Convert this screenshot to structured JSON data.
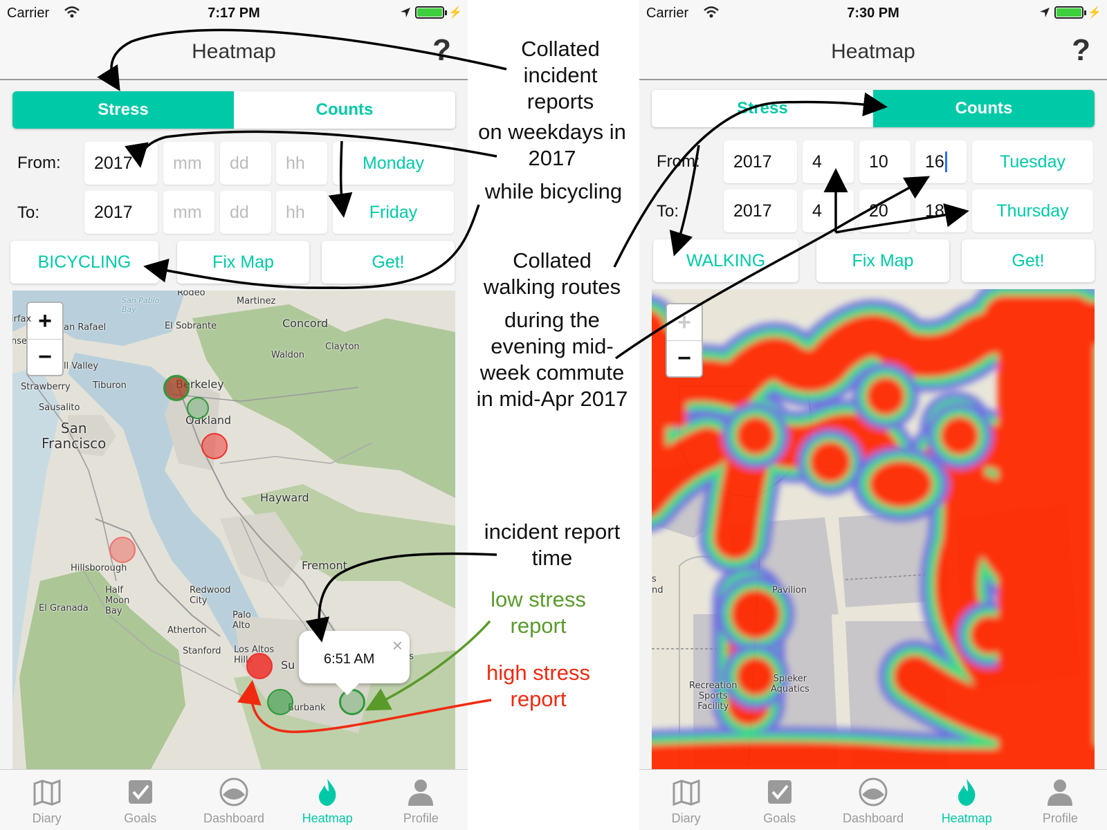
{
  "left": {
    "status": {
      "carrier": "Carrier",
      "time": "7:17 PM"
    },
    "nav_title": "Heatmap",
    "help_label": "?",
    "segments": {
      "stress": "Stress",
      "counts": "Counts",
      "selected": "stress"
    },
    "from_label": "From:",
    "to_label": "To:",
    "from": {
      "year": "2017",
      "month": "mm",
      "day": "dd",
      "hour": "hh",
      "weekday": "Monday"
    },
    "to": {
      "year": "2017",
      "month": "mm",
      "day": "dd",
      "hour": "hh",
      "weekday": "Friday"
    },
    "mode_button": "BICYCLING",
    "fix_map_button": "Fix Map",
    "get_button": "Get!",
    "zoom_in": "+",
    "zoom_out": "−",
    "map_places": {
      "rodeo": "Rodeo",
      "martinez": "Martinez",
      "san_pablo_bay": "San Pablo\nBay",
      "san_rafael": "an Rafael",
      "el_sobrante": "El Sobrante",
      "concord": "Concord",
      "clayton": "Clayton",
      "waldon": "Waldon",
      "mill_valley": "ll Valley",
      "strawberry": "Strawberry",
      "tiburon": "Tiburon",
      "berkeley": "Berkeley",
      "sausalito": "Sausalito",
      "oakland": "Oakland",
      "san_francisco": "San\nFrancisco",
      "hayward": "Hayward",
      "hillsborough": "Hillsborough",
      "fremont": "Fremont",
      "half_moon_bay": "Half\nMoon\nBay",
      "redwood_city": "Redwood\nCity",
      "el_granada": "El Granada",
      "palo_alto": "Palo\nAlto",
      "atherton": "Atherton",
      "stanford": "Stanford",
      "los_altos_hills": "Los Altos\nHills",
      "burbank": "Burbank",
      "fairfax": "irfax",
      "inverness": "nse",
      "su": "Su",
      "se": "se",
      "lls": "lls"
    },
    "popup_time": "6:51 AM",
    "popup_close": "×"
  },
  "right": {
    "status": {
      "carrier": "Carrier",
      "time": "7:30 PM"
    },
    "nav_title": "Heatmap",
    "help_label": "?",
    "segments": {
      "stress": "Stress",
      "counts": "Counts",
      "selected": "counts"
    },
    "from_label": "From:",
    "to_label": "To:",
    "from": {
      "year": "2017",
      "month": "4",
      "day": "10",
      "hour": "16",
      "weekday": "Tuesday"
    },
    "to": {
      "year": "2017",
      "month": "4",
      "day": "20",
      "hour": "18",
      "weekday": "Thursday"
    },
    "mode_button": "WALKING",
    "fix_map_button": "Fix Map",
    "get_button": "Get!",
    "zoom_in": "+",
    "zoom_out": "−",
    "map_places": {
      "pavilion": "Pavilion",
      "recreation": "Recreation\nSports\nFacility",
      "spieker": "Spieker\nAquatics",
      "edge_s": "s",
      "edge_nd": "nd"
    }
  },
  "tabs": [
    {
      "label": "Diary",
      "icon": "map-icon"
    },
    {
      "label": "Goals",
      "icon": "checkbox-icon"
    },
    {
      "label": "Dashboard",
      "icon": "gauge-icon"
    },
    {
      "label": "Heatmap",
      "icon": "flame-icon"
    },
    {
      "label": "Profile",
      "icon": "person-icon"
    }
  ],
  "active_tab": "Heatmap",
  "annotations": {
    "collated_incidents": "Collated\nincident\nreports",
    "weekdays": "on weekdays in\n2017",
    "bicycling": "while bicycling",
    "collated_walking": "Collated\nwalking routes",
    "commute": "during the\nevening mid-\nweek commute\nin mid-Apr 2017",
    "incident_time": "incident report\ntime",
    "low_stress": "low stress\nreport",
    "high_stress": "high stress\nreport"
  },
  "colors": {
    "accent": "#00c9a7",
    "low_stress_marker": "#2e9a3a",
    "high_stress_marker": "#f0302a",
    "low_stress_text": "#5a9a2a",
    "high_stress_text": "#f02a10",
    "heat_red": "#ff2a00",
    "heat_green": "#2fe07a",
    "heat_blue": "#6a6ee0"
  }
}
